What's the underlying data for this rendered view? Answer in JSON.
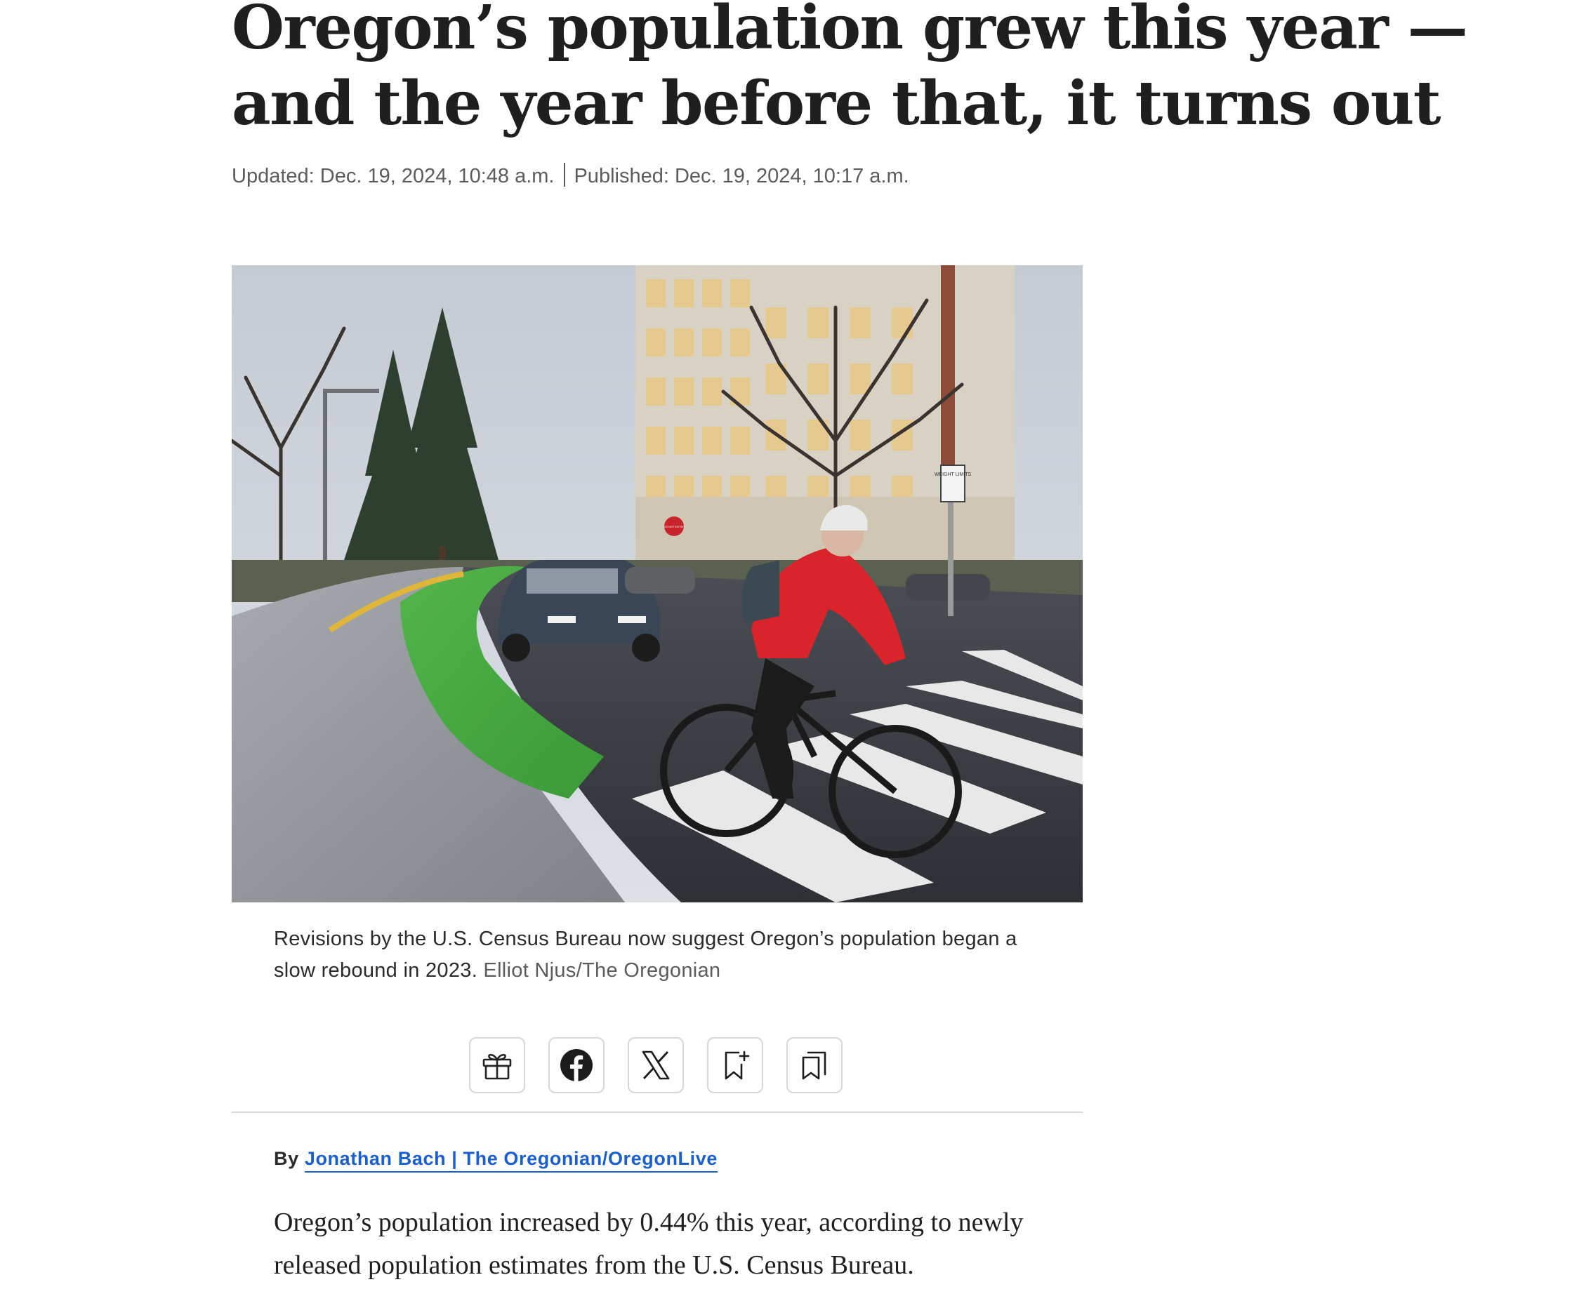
{
  "article": {
    "headline": "Oregon’s population grew this year — and the year before that, it turns out",
    "updated": "Updated: Dec. 19, 2024, 10:48 a.m.",
    "published": "Published: Dec. 19, 2024, 10:17 a.m."
  },
  "photo": {
    "caption": "Revisions by the U.S. Census Bureau now suggest Oregon’s population began a slow rebound in 2023.",
    "credit": "Elliot Njus/The Oregonian",
    "signs": {
      "do_not_enter": "DO NOT ENTER",
      "weight_limits": "WEIGHT LIMITS"
    }
  },
  "share": {
    "buttons": [
      {
        "name": "gift-article",
        "icon": "gift-icon"
      },
      {
        "name": "share-facebook",
        "icon": "facebook-icon"
      },
      {
        "name": "share-x",
        "icon": "x-icon"
      },
      {
        "name": "save-article",
        "icon": "bookmark-add-icon"
      },
      {
        "name": "saved-articles",
        "icon": "bookmarks-icon"
      }
    ]
  },
  "byline": {
    "prefix": "By",
    "author_link": "Jonathan Bach | The Oregonian/OregonLive"
  },
  "body": {
    "paragraph_1": "Oregon’s population increased by 0.44% this year, according to newly released population estimates from the U.S. Census Bureau."
  },
  "colors": {
    "link": "#1a5fd0",
    "bike_lane": "#3fa63d",
    "jacket": "#d9242b"
  }
}
